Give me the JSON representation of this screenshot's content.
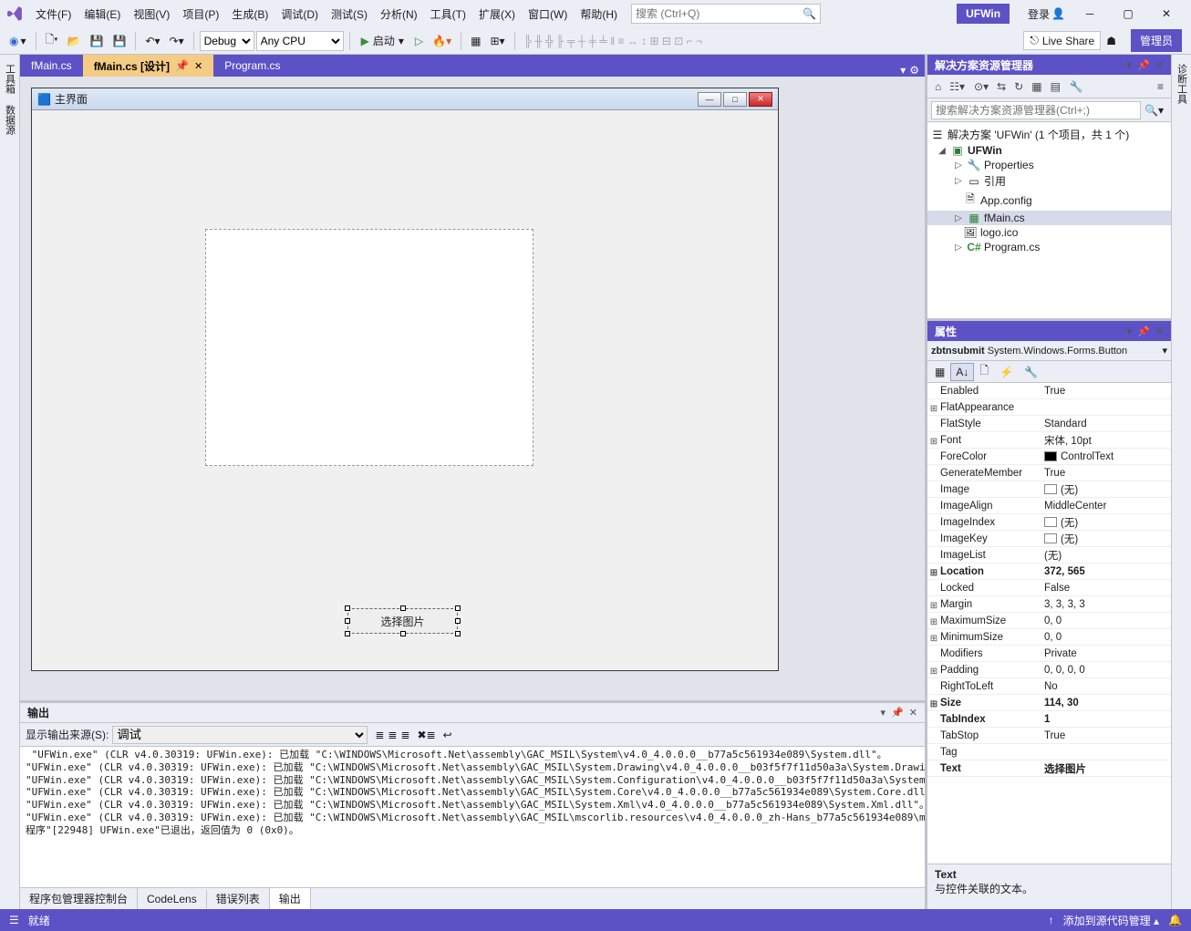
{
  "app_badge": "UFWin",
  "menubar": {
    "items": [
      "文件(F)",
      "编辑(E)",
      "视图(V)",
      "项目(P)",
      "生成(B)",
      "调试(D)",
      "测试(S)",
      "分析(N)",
      "工具(T)",
      "扩展(X)",
      "窗口(W)",
      "帮助(H)"
    ],
    "search_placeholder": "搜索 (Ctrl+Q)",
    "login": "登录"
  },
  "toolbar": {
    "config": "Debug",
    "platform": "Any CPU",
    "start": "启动",
    "liveshare": "Live Share",
    "admin": "管理员"
  },
  "left_strips": [
    "工具箱",
    "数据源"
  ],
  "right_strip": "诊断工具",
  "doc_tabs": {
    "items": [
      "fMain.cs",
      "fMain.cs [设计]",
      "Program.cs"
    ],
    "active_index": 1
  },
  "designer": {
    "form_title": "主界面",
    "button_label": "选择图片"
  },
  "output": {
    "panel_title": "输出",
    "source_label": "显示输出来源(S):",
    "source_value": "调试",
    "lines": [
      " \"UFWin.exe\" (CLR v4.0.30319: UFWin.exe): 已加载 \"C:\\WINDOWS\\Microsoft.Net\\assembly\\GAC_MSIL\\System\\v4.0_4.0.0.0__b77a5c561934e089\\System.dll\"。",
      "\"UFWin.exe\" (CLR v4.0.30319: UFWin.exe): 已加载 \"C:\\WINDOWS\\Microsoft.Net\\assembly\\GAC_MSIL\\System.Drawing\\v4.0_4.0.0.0__b03f5f7f11d50a3a\\System.Drawing.",
      "\"UFWin.exe\" (CLR v4.0.30319: UFWin.exe): 已加载 \"C:\\WINDOWS\\Microsoft.Net\\assembly\\GAC_MSIL\\System.Configuration\\v4.0_4.0.0.0__b03f5f7f11d50a3a\\System.Cc",
      "\"UFWin.exe\" (CLR v4.0.30319: UFWin.exe): 已加载 \"C:\\WINDOWS\\Microsoft.Net\\assembly\\GAC_MSIL\\System.Core\\v4.0_4.0.0.0__b77a5c561934e089\\System.Core.dll\"。",
      "\"UFWin.exe\" (CLR v4.0.30319: UFWin.exe): 已加载 \"C:\\WINDOWS\\Microsoft.Net\\assembly\\GAC_MSIL\\System.Xml\\v4.0_4.0.0.0__b77a5c561934e089\\System.Xml.dll\"。",
      "\"UFWin.exe\" (CLR v4.0.30319: UFWin.exe): 已加载 \"C:\\WINDOWS\\Microsoft.Net\\assembly\\GAC_MSIL\\mscorlib.resources\\v4.0_4.0.0.0_zh-Hans_b77a5c561934e089\\mscc",
      "程序\"[22948] UFWin.exe\"已退出，返回值为 0 (0x0)。"
    ]
  },
  "bottom_tabs": {
    "items": [
      "程序包管理器控制台",
      "CodeLens",
      "错误列表",
      "输出"
    ],
    "active_index": 3
  },
  "solution": {
    "panel_title": "解决方案资源管理器",
    "search_placeholder": "搜索解决方案资源管理器(Ctrl+;)",
    "root": "解决方案 'UFWin' (1 个项目，共 1 个)",
    "project": "UFWin",
    "nodes": [
      "Properties",
      "引用",
      "App.config",
      "fMain.cs",
      "logo.ico",
      "Program.cs"
    ]
  },
  "properties": {
    "panel_title": "属性",
    "selector_name": "zbtnsubmit",
    "selector_type": "System.Windows.Forms.Button",
    "rows": [
      {
        "exp": "",
        "name": "Enabled",
        "value": "True"
      },
      {
        "exp": "+",
        "name": "FlatAppearance",
        "value": ""
      },
      {
        "exp": "",
        "name": "FlatStyle",
        "value": "Standard"
      },
      {
        "exp": "+",
        "name": "Font",
        "value": "宋体, 10pt"
      },
      {
        "exp": "",
        "name": "ForeColor",
        "value": "ControlText",
        "swatch": "#000000"
      },
      {
        "exp": "",
        "name": "GenerateMember",
        "value": "True"
      },
      {
        "exp": "",
        "name": "Image",
        "value": "(无)",
        "swatch": "#ffffff"
      },
      {
        "exp": "",
        "name": "ImageAlign",
        "value": "MiddleCenter"
      },
      {
        "exp": "",
        "name": "ImageIndex",
        "value": "(无)",
        "swatch": "#ffffff"
      },
      {
        "exp": "",
        "name": "ImageKey",
        "value": "(无)",
        "swatch": "#ffffff"
      },
      {
        "exp": "",
        "name": "ImageList",
        "value": "(无)"
      },
      {
        "exp": "+",
        "name": "Location",
        "value": "372, 565",
        "bold": true
      },
      {
        "exp": "",
        "name": "Locked",
        "value": "False"
      },
      {
        "exp": "+",
        "name": "Margin",
        "value": "3, 3, 3, 3"
      },
      {
        "exp": "+",
        "name": "MaximumSize",
        "value": "0, 0"
      },
      {
        "exp": "+",
        "name": "MinimumSize",
        "value": "0, 0"
      },
      {
        "exp": "",
        "name": "Modifiers",
        "value": "Private"
      },
      {
        "exp": "+",
        "name": "Padding",
        "value": "0, 0, 0, 0"
      },
      {
        "exp": "",
        "name": "RightToLeft",
        "value": "No"
      },
      {
        "exp": "+",
        "name": "Size",
        "value": "114, 30",
        "bold": true
      },
      {
        "exp": "",
        "name": "TabIndex",
        "value": "1",
        "bold": true
      },
      {
        "exp": "",
        "name": "TabStop",
        "value": "True"
      },
      {
        "exp": "",
        "name": "Tag",
        "value": ""
      },
      {
        "exp": "",
        "name": "Text",
        "value": "选择图片",
        "bold": true
      }
    ],
    "desc_name": "Text",
    "desc_text": "与控件关联的文本。"
  },
  "statusbar": {
    "ready": "就绪",
    "source_control": "添加到源代码管理"
  }
}
